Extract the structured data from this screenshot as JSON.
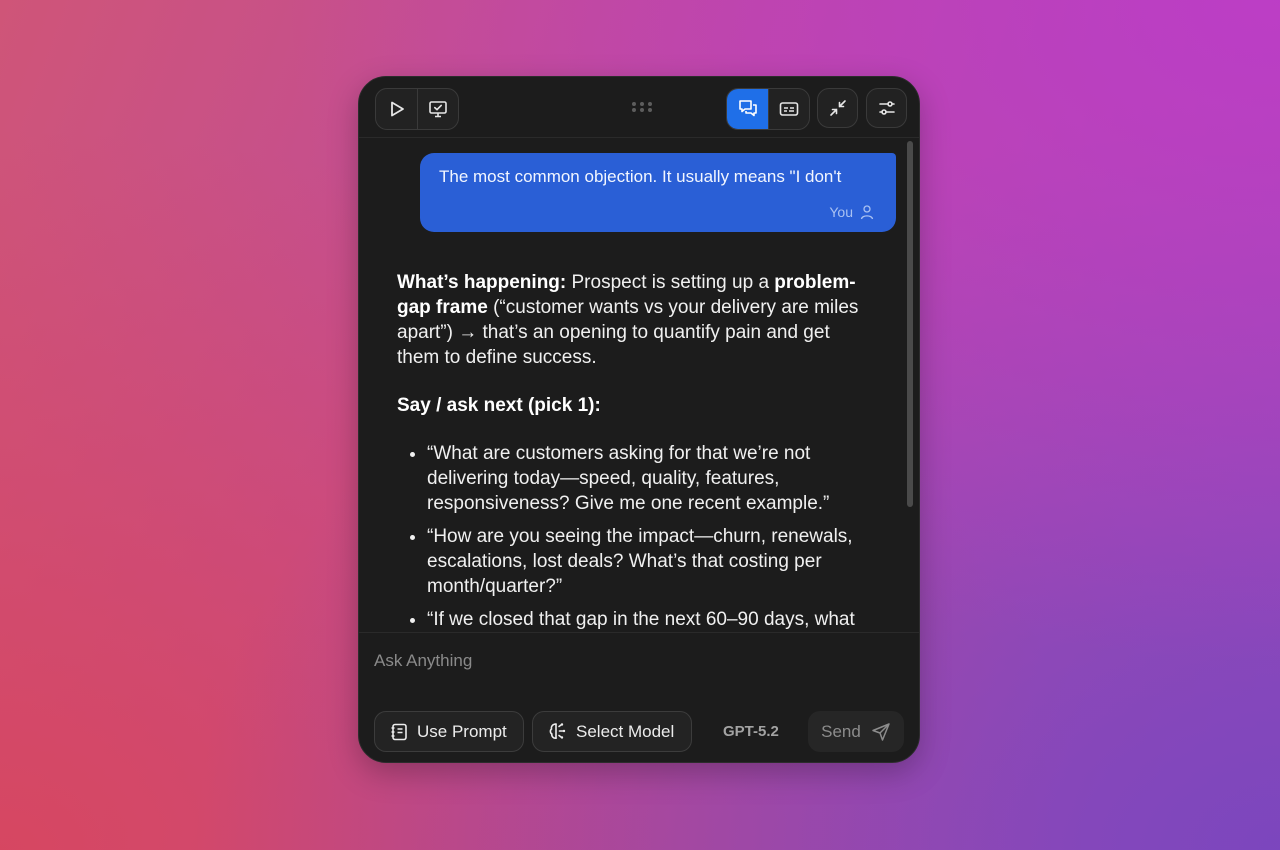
{
  "toolbar": {
    "icons": {
      "play": "play-icon",
      "screen": "screen-check-icon",
      "drag": "drag-handle-icon",
      "chat_view": "chat-bubbles-icon",
      "transcript_view": "captions-icon",
      "minimize": "minimize-icon",
      "settings": "sliders-icon"
    },
    "active_view": "chat",
    "accent": "#1f6fe8"
  },
  "user_message": {
    "text": "The most common objection. It usually means \"I don't",
    "author": "You",
    "bubble_color": "#2a5fd6"
  },
  "assistant_message": {
    "p1_bold1": "What’s happening:",
    "p1_text1": " Prospect is setting up a ",
    "p1_bold2": "problem-gap frame",
    "p1_text2": " (“customer wants vs your delivery are miles apart”) → that’s an opening to quantify pain and get them to define success.",
    "heading": "Say / ask next (pick 1):",
    "bullets": [
      "“What are customers asking for that we’re not delivering today—speed, quality, features, responsiveness? Give me one recent example.”",
      "“How are you seeing the impact—churn, renewals, escalations, lost deals? What’s that costing per month/quarter?”",
      "“If we closed that gap in the next 60–90 days, what"
    ]
  },
  "composer": {
    "placeholder": "Ask Anything",
    "use_prompt_label": "Use Prompt",
    "select_model_label": "Select Model",
    "model_name": "GPT-5.2",
    "send_label": "Send"
  }
}
